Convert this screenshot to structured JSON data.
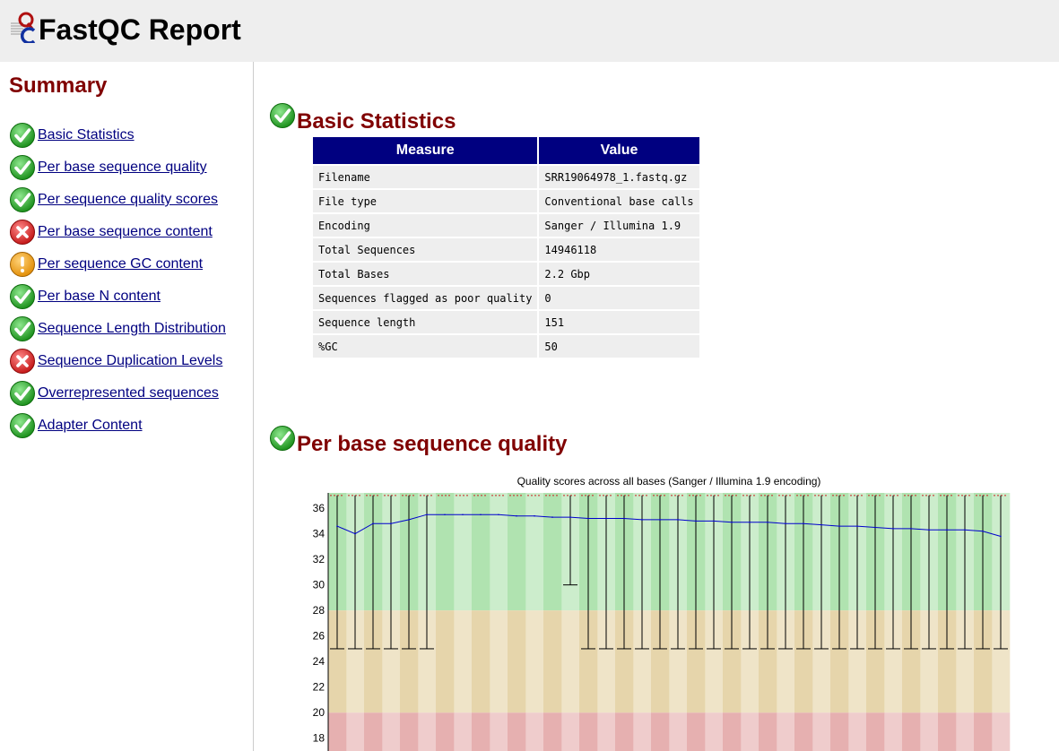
{
  "header": {
    "title": "FastQC Report"
  },
  "sidebar": {
    "title": "Summary",
    "items": [
      {
        "label": "Basic Statistics",
        "status": "pass"
      },
      {
        "label": "Per base sequence quality",
        "status": "pass"
      },
      {
        "label": "Per sequence quality scores",
        "status": "pass"
      },
      {
        "label": "Per base sequence content",
        "status": "fail"
      },
      {
        "label": "Per sequence GC content",
        "status": "warn"
      },
      {
        "label": "Per base N content",
        "status": "pass"
      },
      {
        "label": "Sequence Length Distribution",
        "status": "pass"
      },
      {
        "label": "Sequence Duplication Levels",
        "status": "fail"
      },
      {
        "label": "Overrepresented sequences",
        "status": "pass"
      },
      {
        "label": "Adapter Content",
        "status": "pass"
      }
    ]
  },
  "colors": {
    "pass": "#22aa22",
    "fail": "#dd2222",
    "warn": "#f0a000",
    "title": "#800000",
    "table_header": "#000080",
    "link": "#000080"
  },
  "basic_statistics": {
    "title": "Basic Statistics",
    "status": "pass",
    "headers": [
      "Measure",
      "Value"
    ],
    "rows": [
      [
        "Filename",
        "SRR19064978_1.fastq.gz"
      ],
      [
        "File type",
        "Conventional base calls"
      ],
      [
        "Encoding",
        "Sanger / Illumina 1.9"
      ],
      [
        "Total Sequences",
        "14946118"
      ],
      [
        "Total Bases",
        "2.2 Gbp"
      ],
      [
        "Sequences flagged as poor quality",
        "0"
      ],
      [
        "Sequence length",
        "151"
      ],
      [
        "%GC",
        "50"
      ]
    ]
  },
  "per_base_quality": {
    "title": "Per base sequence quality",
    "status": "pass"
  },
  "chart_data": {
    "type": "box",
    "title": "Quality scores across all bases (Sanger / Illumina 1.9 encoding)",
    "y_ticks": [
      18,
      20,
      22,
      24,
      26,
      28,
      30,
      32,
      34,
      36
    ],
    "y_visible_range": [
      17,
      37.2
    ],
    "zones": [
      {
        "name": "good",
        "from": 28,
        "to": 37.2,
        "color": "#b0e3b0"
      },
      {
        "name": "reasonable",
        "from": 20,
        "to": 28,
        "color": "#e6d5ab"
      },
      {
        "name": "poor",
        "from": 0,
        "to": 20,
        "color": "#e6b0b0"
      }
    ],
    "bins": 38,
    "upper_whisker": 37,
    "lower_whisker": [
      25,
      25,
      25,
      25,
      25,
      25,
      25,
      25,
      25,
      25,
      25,
      25,
      25,
      30,
      25,
      25,
      25,
      25,
      25,
      25,
      25,
      25,
      25,
      25,
      25,
      25,
      25,
      25,
      25,
      25,
      25,
      25,
      25,
      25,
      25,
      25,
      25,
      25
    ],
    "whisker_visible": [
      1,
      1,
      1,
      1,
      1,
      1,
      0,
      0,
      0,
      0,
      0,
      0,
      0,
      1,
      1,
      1,
      1,
      1,
      1,
      1,
      1,
      1,
      1,
      1,
      1,
      1,
      1,
      1,
      1,
      1,
      1,
      1,
      1,
      1,
      1,
      1,
      1,
      1
    ],
    "mean": [
      34.6,
      34.0,
      34.8,
      34.8,
      35.1,
      35.5,
      35.5,
      35.5,
      35.5,
      35.5,
      35.4,
      35.4,
      35.3,
      35.3,
      35.2,
      35.2,
      35.2,
      35.1,
      35.1,
      35.1,
      35.0,
      35.0,
      34.9,
      34.9,
      34.9,
      34.8,
      34.8,
      34.7,
      34.6,
      34.6,
      34.5,
      34.4,
      34.4,
      34.3,
      34.3,
      34.3,
      34.2,
      33.8
    ]
  }
}
